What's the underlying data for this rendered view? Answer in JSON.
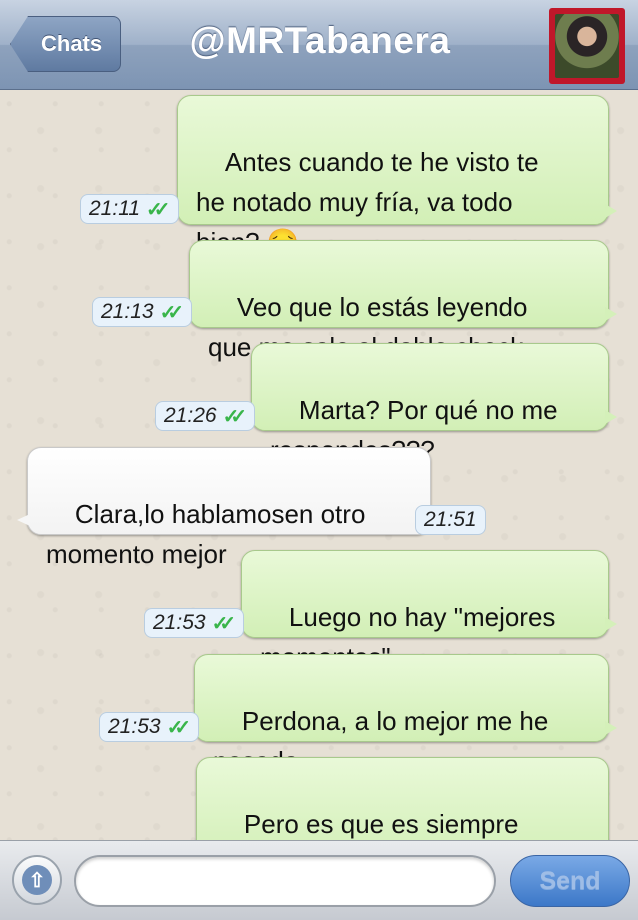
{
  "header": {
    "back_label": "Chats",
    "contact_name": "@MRTabanera"
  },
  "messages": [
    {
      "direction": "out",
      "text": "Antes cuando te he visto te\nhe notado muy fría, va todo\nbien? 😔",
      "time": "21:11",
      "read": true
    },
    {
      "direction": "out",
      "text": "Veo que lo estás leyendo\nque me sale el doble check",
      "time": "21:13",
      "read": true
    },
    {
      "direction": "out",
      "text": "Marta? Por qué no me\nrespondes???",
      "time": "21:26",
      "read": true
    },
    {
      "direction": "in",
      "text": "Clara,lo hablamosen otro\nmomento mejor",
      "time": "21:51"
    },
    {
      "direction": "out",
      "text": "Luego no hay \"mejores\nmomentos\"",
      "time": "21:53",
      "read": true
    },
    {
      "direction": "out",
      "text": "Perdona, a lo mejor me he\npasado",
      "time": "21:53",
      "read": true
    },
    {
      "direction": "out",
      "text": "Pero es que es siempre\nasí... No entiendo por qué",
      "time": "",
      "read": false
    }
  ],
  "composer": {
    "input_value": "",
    "send_label": "Send"
  },
  "icons": {
    "back": "chevron-left-icon",
    "attach": "up-arrow-icon",
    "read_receipt": "double-check-icon"
  },
  "colors": {
    "outgoing_bubble": "#dcf8c6",
    "incoming_bubble": "#ffffff",
    "read_check": "#39b54a",
    "navbar": "#8ea2bd"
  }
}
